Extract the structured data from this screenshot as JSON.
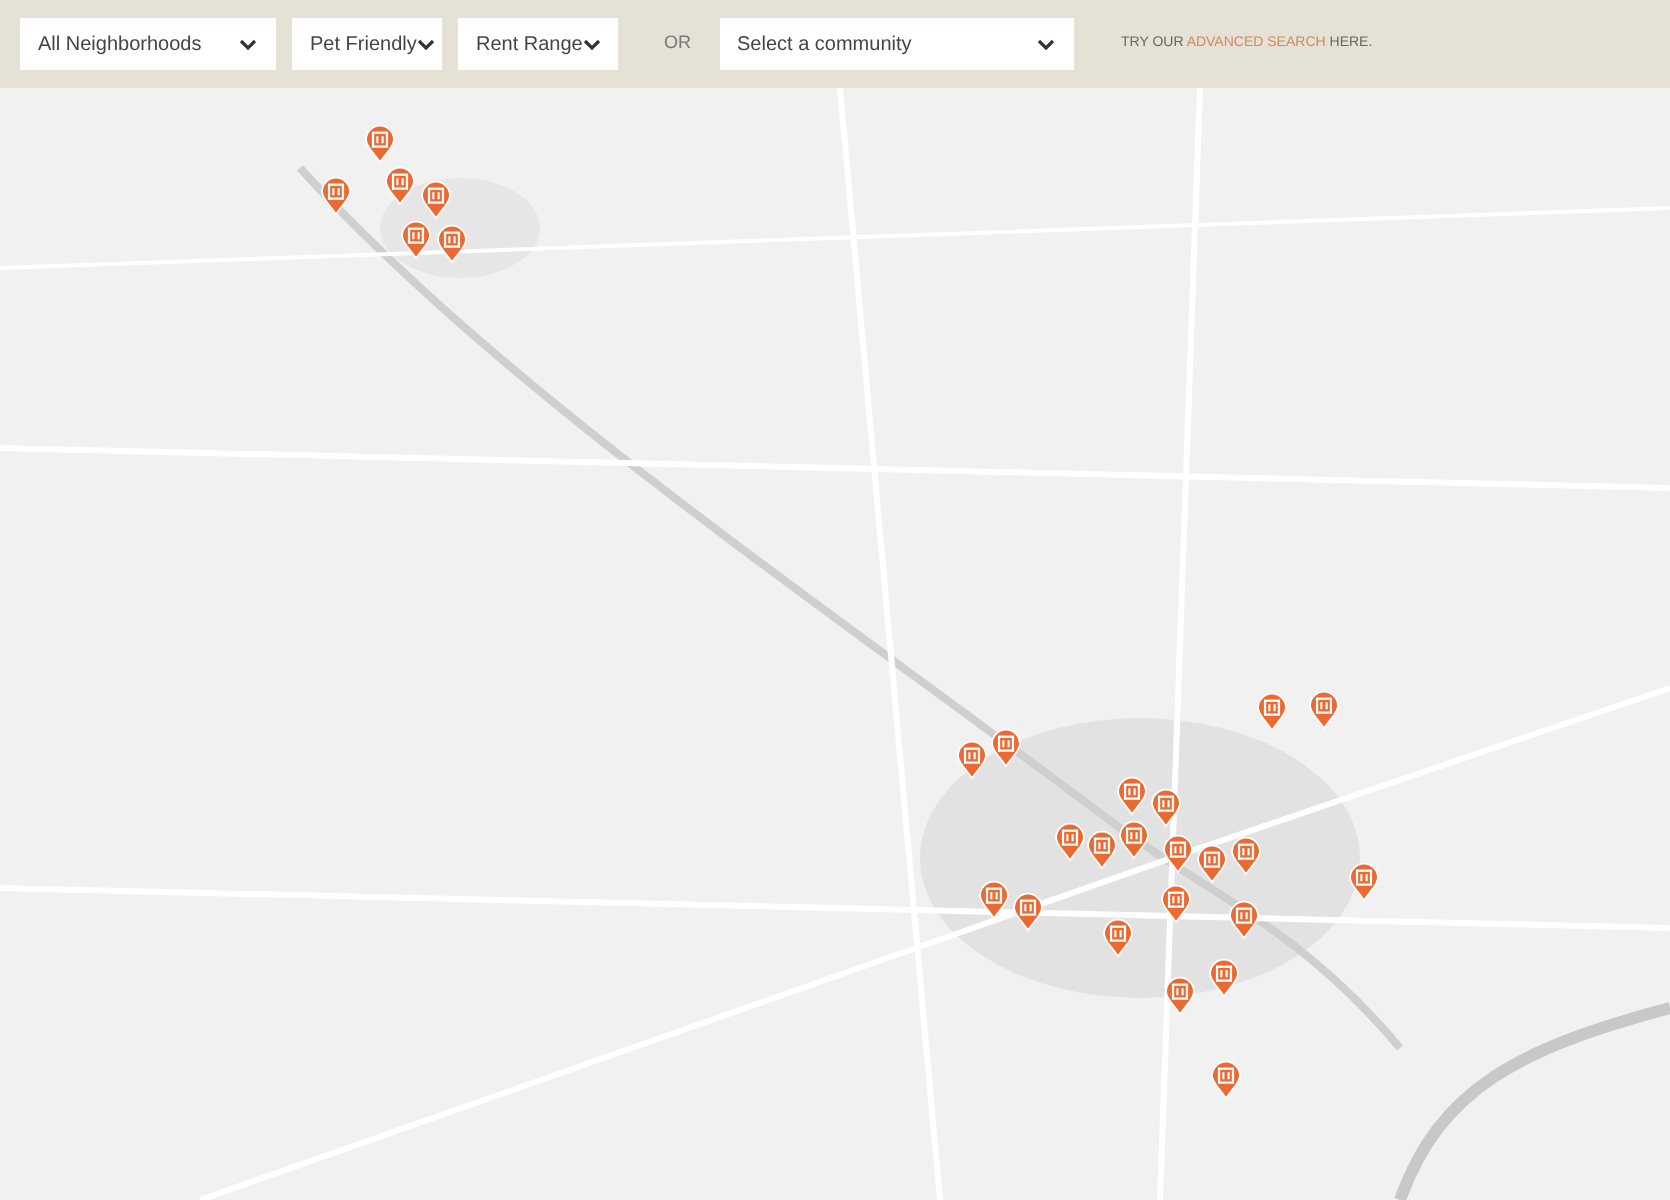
{
  "filters": [
    {
      "label": "All Neighborhoods"
    },
    {
      "label": "Pet Friendly"
    },
    {
      "label": "Rent Range"
    }
  ],
  "or_label": "OR",
  "community_select": {
    "label": "Select a community"
  },
  "advanced_search": {
    "before": "TRY OUR",
    "link": "ADVANCED SEARCH",
    "after": "HERE."
  }
}
